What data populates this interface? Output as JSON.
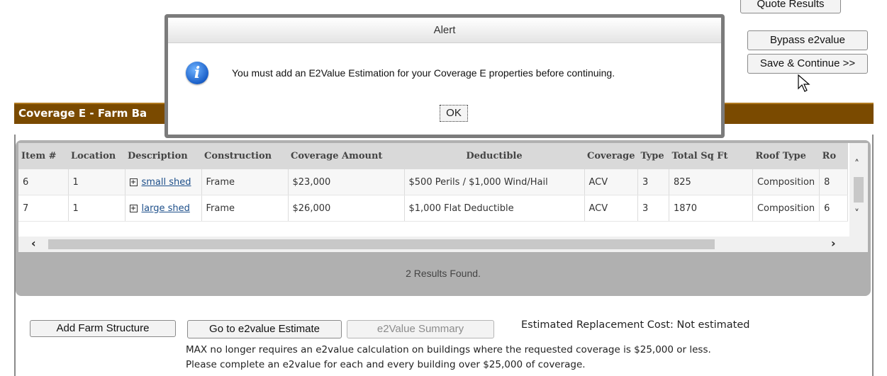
{
  "top_buttons": {
    "quote_results": "Quote Results",
    "bypass": "Bypass e2value",
    "save_continue": "Save & Continue >>"
  },
  "section": {
    "title": "Coverage E - Farm Ba"
  },
  "grid": {
    "columns": [
      "Item #",
      "Location",
      "Description",
      "Construction",
      "Coverage Amount",
      "Deductible",
      "Coverage",
      "Type",
      "Total Sq Ft",
      "Roof Type",
      "Ro"
    ],
    "rows": [
      {
        "item": "6",
        "location": "1",
        "description": "small shed",
        "construction": "Frame",
        "coverage_amount": "$23,000",
        "deductible": "$500 Perils / $1,000 Wind/Hail",
        "coverage": "ACV",
        "type": "3",
        "sqft": "825",
        "roof": "Composition",
        "ro": "8"
      },
      {
        "item": "7",
        "location": "1",
        "description": "large shed",
        "construction": "Frame",
        "coverage_amount": "$26,000",
        "deductible": "$1,000 Flat Deductible",
        "coverage": "ACV",
        "type": "3",
        "sqft": "1870",
        "roof": "Composition",
        "ro": "6"
      }
    ],
    "results_text": "2 Results Found."
  },
  "bottom": {
    "add_structure": "Add Farm Structure",
    "goto_e2value": "Go to e2value Estimate",
    "e2value_summary": "e2Value Summary",
    "estimated_cost": "Estimated Replacement Cost: Not estimated",
    "note_line1": "MAX no longer requires an e2value calculation on buildings where the requested coverage is $25,000 or less.",
    "note_line2": "Please complete an e2value for each and every building over $25,000 of coverage."
  },
  "dialog": {
    "title": "Alert",
    "message": "You must add an E2Value Estimation for your Coverage E properties before continuing.",
    "ok": "OK",
    "icon": "info-icon"
  }
}
